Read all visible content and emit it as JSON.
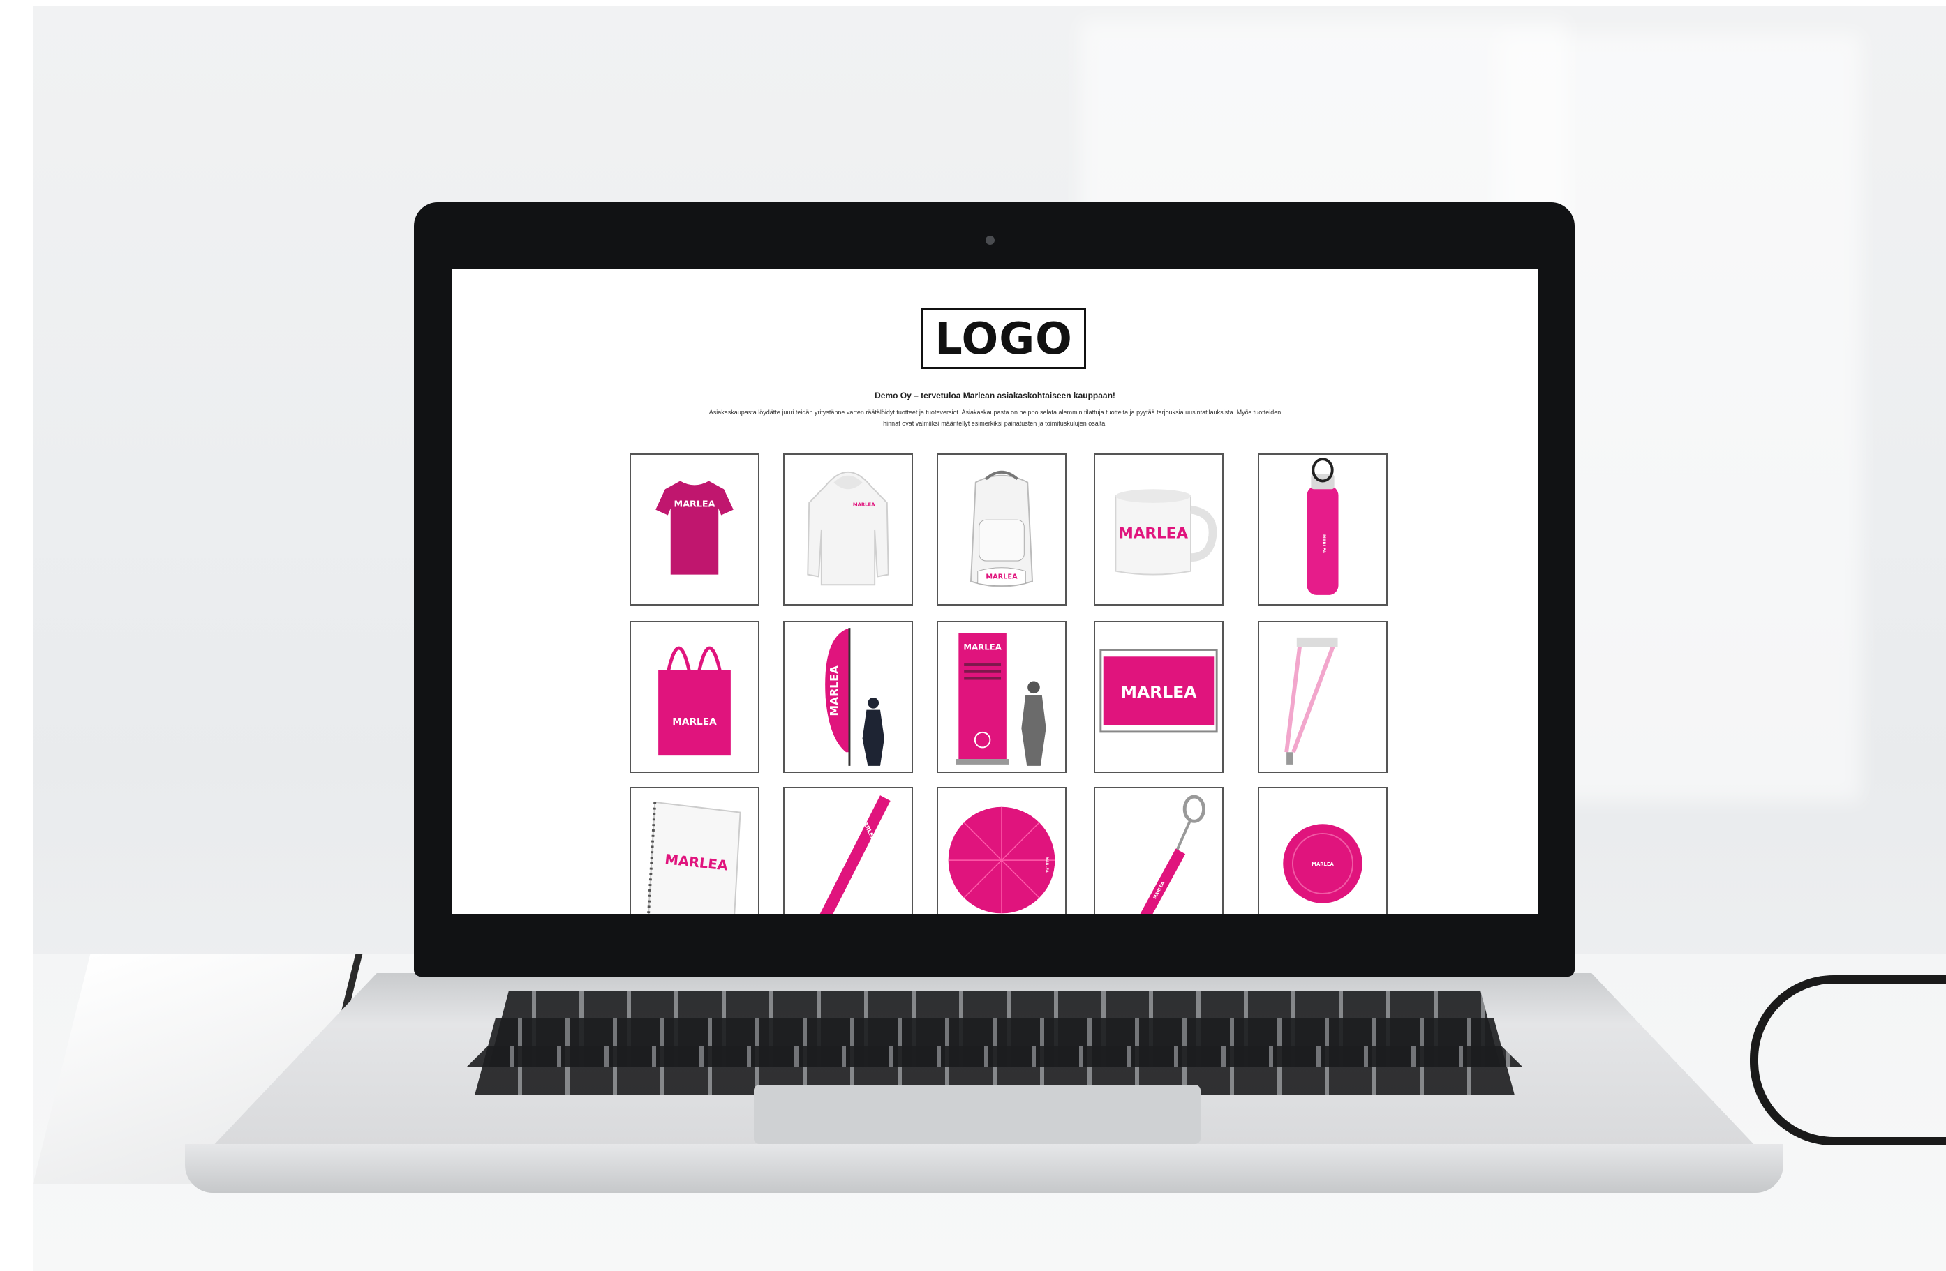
{
  "page": {
    "logo_text": "LOGO",
    "welcome_heading": "Demo Oy – tervetuloa Marlean asiakaskohtaiseen kauppaan!",
    "intro_text": "Asiakaskaupasta löydätte juuri teidän yritystänne varten räätälöidyt tuotteet ja tuoteversiot. Asiakaskaupasta on helppo selata alemmin tilattuja tuotteita ja pyytää tarjouksia uusintatilauksista. Myös tuotteiden hinnat ovat valmiiksi määritellyt esimerkiksi painatusten ja toimituskulujen osalta."
  },
  "brand": {
    "name": "MARLEA",
    "accent_color": "#e0147d"
  },
  "products": [
    {
      "icon": "tshirt-icon",
      "brand": "MARLEA"
    },
    {
      "icon": "hoodie-icon",
      "brand": "MARLEA"
    },
    {
      "icon": "backpack-icon",
      "brand": "MARLEA"
    },
    {
      "icon": "mug-icon",
      "brand": "MARLEA"
    },
    {
      "icon": "water-bottle-icon",
      "brand": "MARLEA"
    },
    {
      "icon": "tote-bag-icon",
      "brand": "MARLEA"
    },
    {
      "icon": "beach-flag-icon",
      "brand": "MARLEA"
    },
    {
      "icon": "rollup-banner-icon",
      "brand": "MARLEA"
    },
    {
      "icon": "fence-banner-icon",
      "brand": "MARLEA"
    },
    {
      "icon": "lanyard-icon",
      "brand": ""
    },
    {
      "icon": "notebook-icon",
      "brand": "MARLEA"
    },
    {
      "icon": "pen-icon",
      "brand": "MARLEA"
    },
    {
      "icon": "umbrella-icon",
      "brand": "MARLEA"
    },
    {
      "icon": "keychain-flashlight-icon",
      "brand": "MARLEA"
    },
    {
      "icon": "frisbee-icon",
      "brand": "MARLEA"
    }
  ]
}
